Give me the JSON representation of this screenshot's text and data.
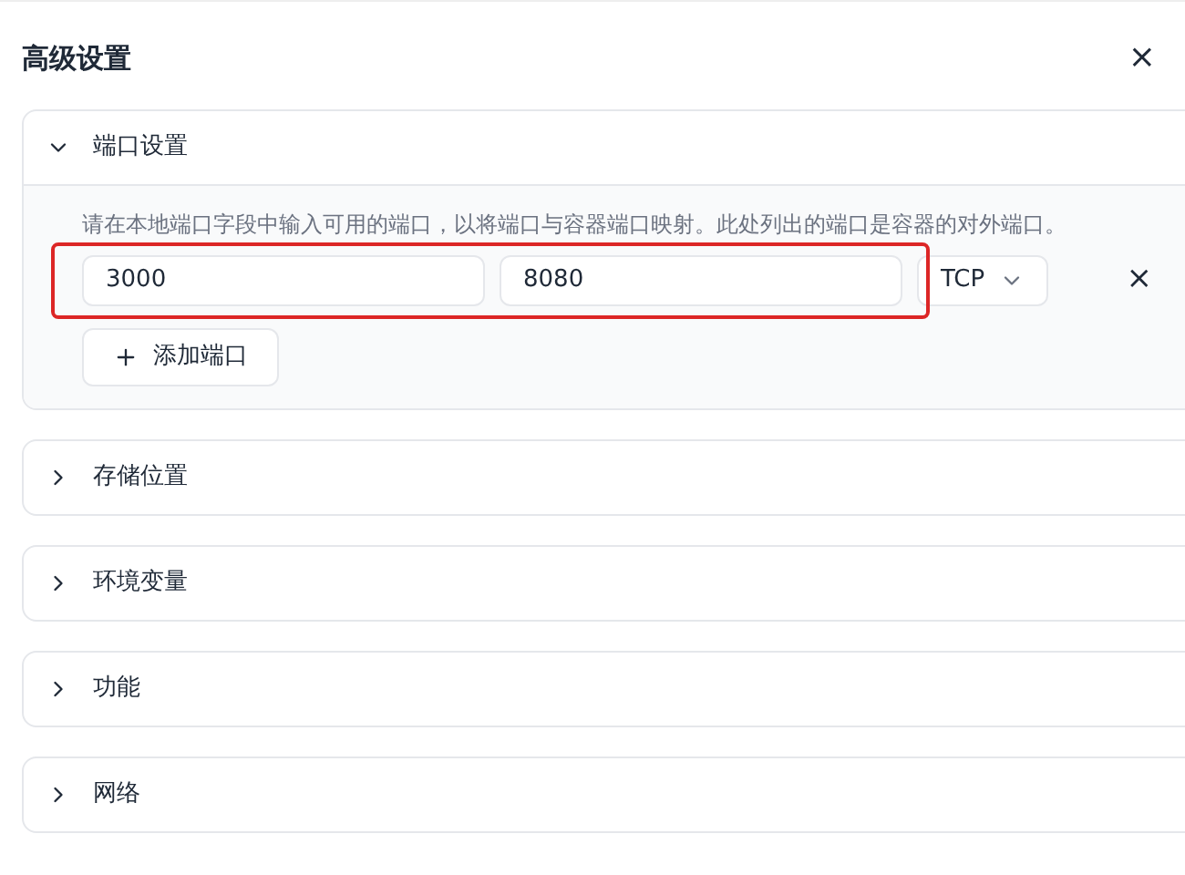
{
  "dialog": {
    "title": "高级设置",
    "close": "×"
  },
  "sections": [
    {
      "title": "端口设置",
      "expanded": true,
      "description": "请在本地端口字段中输入可用的端口，以将端口与容器端口映射。此处列出的端口是容器的对外端口。",
      "ports": [
        {
          "local": "3000",
          "container": "8080",
          "protocol": "TCP",
          "highlighted": true,
          "remove": "×"
        }
      ],
      "add_button": "添加端口"
    },
    {
      "title": "存储位置",
      "expanded": false
    },
    {
      "title": "环境变量",
      "expanded": false
    },
    {
      "title": "功能",
      "expanded": false
    },
    {
      "title": "网络",
      "expanded": false
    }
  ]
}
